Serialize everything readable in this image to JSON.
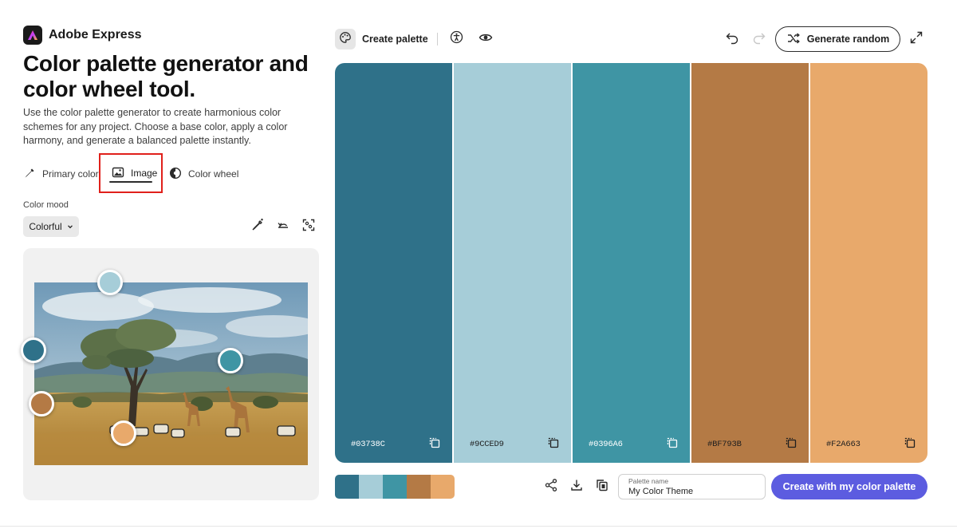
{
  "brand": {
    "name": "Adobe Express"
  },
  "hero": {
    "title": "Color palette generator and color wheel tool.",
    "description": "Use the color palette generator to create harmonious color schemes for any project. Choose a base color, apply a color harmony, and generate a balanced palette instantly."
  },
  "tabs": [
    {
      "label": "Primary color",
      "icon": "eyedropper-icon",
      "active": false
    },
    {
      "label": "Image",
      "icon": "image-icon",
      "active": true
    },
    {
      "label": "Color wheel",
      "icon": "color-wheel-icon",
      "active": false
    }
  ],
  "mood": {
    "label": "Color mood",
    "value": "Colorful"
  },
  "tools": [
    "magic-eyedropper-icon",
    "reset-icon",
    "scan-image-icon"
  ],
  "toolbar": {
    "create_palette": "Create palette",
    "generate_random": "Generate random",
    "icons": [
      "palette-icon",
      "accessibility-icon",
      "eye-icon",
      "undo-icon",
      "redo-icon",
      "shuffle-icon",
      "expand-icon"
    ]
  },
  "palette": [
    {
      "hex": "#03738C",
      "display": "#2F7189",
      "text_color": "#ffffff"
    },
    {
      "hex": "#9CCED9",
      "display": "#A6CDD8",
      "text_color": "#1f1f1f"
    },
    {
      "hex": "#0396A6",
      "display": "#3F95A4",
      "text_color": "#ffffff"
    },
    {
      "hex": "#BF793B",
      "display": "#B47A45",
      "text_color": "#1f1f1f"
    },
    {
      "hex": "#F2A663",
      "display": "#E8A96B",
      "text_color": "#1f1f1f"
    }
  ],
  "palette_name": {
    "label": "Palette name",
    "value": "My Color Theme"
  },
  "cta": {
    "label": "Create with my color palette"
  },
  "colors": {
    "accent": "#5C5CE0",
    "highlight": "#E0201B",
    "panel": "#F1F1F1"
  }
}
